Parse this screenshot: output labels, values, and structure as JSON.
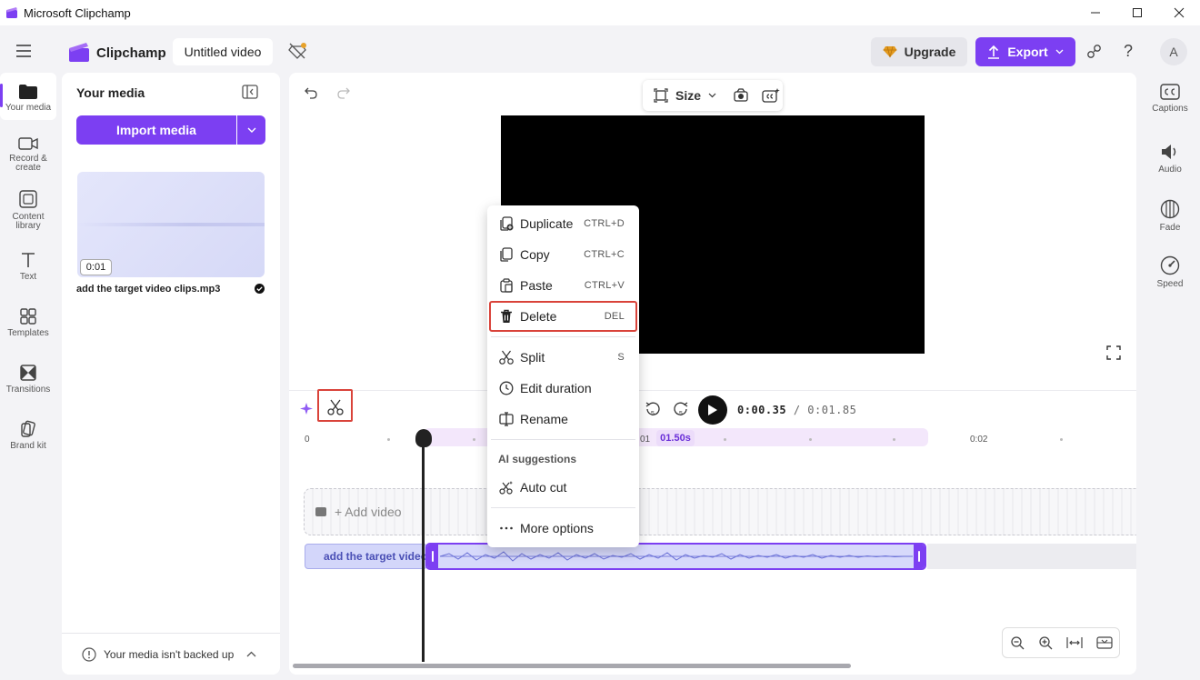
{
  "window": {
    "title": "Microsoft Clipchamp"
  },
  "appbar": {
    "brand": "Clipchamp",
    "project_title": "Untitled video",
    "upgrade_label": "Upgrade",
    "export_label": "Export",
    "avatar_initial": "A",
    "help_label": "?"
  },
  "left_rail": {
    "items": [
      {
        "label": "Your media",
        "icon": "folder-icon",
        "active": true
      },
      {
        "label": "Record & create",
        "icon": "camera-icon"
      },
      {
        "label": "Content library",
        "icon": "content-library-icon"
      },
      {
        "label": "Text",
        "icon": "text-icon"
      },
      {
        "label": "Templates",
        "icon": "templates-icon"
      },
      {
        "label": "Transitions",
        "icon": "transitions-icon"
      },
      {
        "label": "Brand kit",
        "icon": "brand-kit-icon"
      }
    ]
  },
  "media_panel": {
    "title": "Your media",
    "import_label": "Import media",
    "item": {
      "duration": "0:01",
      "name": "add the target video clips.mp3"
    },
    "backup_text": "Your media isn't backed up"
  },
  "editor": {
    "size_label": "Size",
    "timecode_current": "0:00.35",
    "timecode_total": "/ 0:01.85",
    "ruler": [
      "0",
      "01",
      "0:02"
    ],
    "marker_badge": "01.50s",
    "add_video_label": "+ Add video",
    "audio_clip_label": "add the target video clips.mp3",
    "rewind_seconds": "5",
    "forward_seconds": "5"
  },
  "right_rail": {
    "items": [
      {
        "label": "Captions",
        "icon": "captions-icon"
      },
      {
        "label": "Audio",
        "icon": "audio-icon"
      },
      {
        "label": "Fade",
        "icon": "fade-icon"
      },
      {
        "label": "Speed",
        "icon": "speed-icon"
      }
    ]
  },
  "context_menu": {
    "items": [
      {
        "label": "Duplicate",
        "shortcut": "CTRL+D",
        "icon": "duplicate-icon"
      },
      {
        "label": "Copy",
        "shortcut": "CTRL+C",
        "icon": "copy-icon"
      },
      {
        "label": "Paste",
        "shortcut": "CTRL+V",
        "icon": "paste-icon"
      },
      {
        "label": "Delete",
        "shortcut": "DEL",
        "icon": "trash-icon",
        "highlighted": true
      },
      {
        "label": "Split",
        "shortcut": "S",
        "icon": "scissors-icon"
      },
      {
        "label": "Edit duration",
        "shortcut": "",
        "icon": "clock-icon"
      },
      {
        "label": "Rename",
        "shortcut": "",
        "icon": "rename-icon"
      }
    ],
    "ai_section_title": "AI suggestions",
    "ai_items": [
      {
        "label": "Auto cut",
        "icon": "auto-cut-icon"
      }
    ],
    "more_label": "More options"
  },
  "colors": {
    "accent": "#7c3ff2",
    "highlight_box": "#d9433a",
    "preview_bg": "#000000"
  }
}
